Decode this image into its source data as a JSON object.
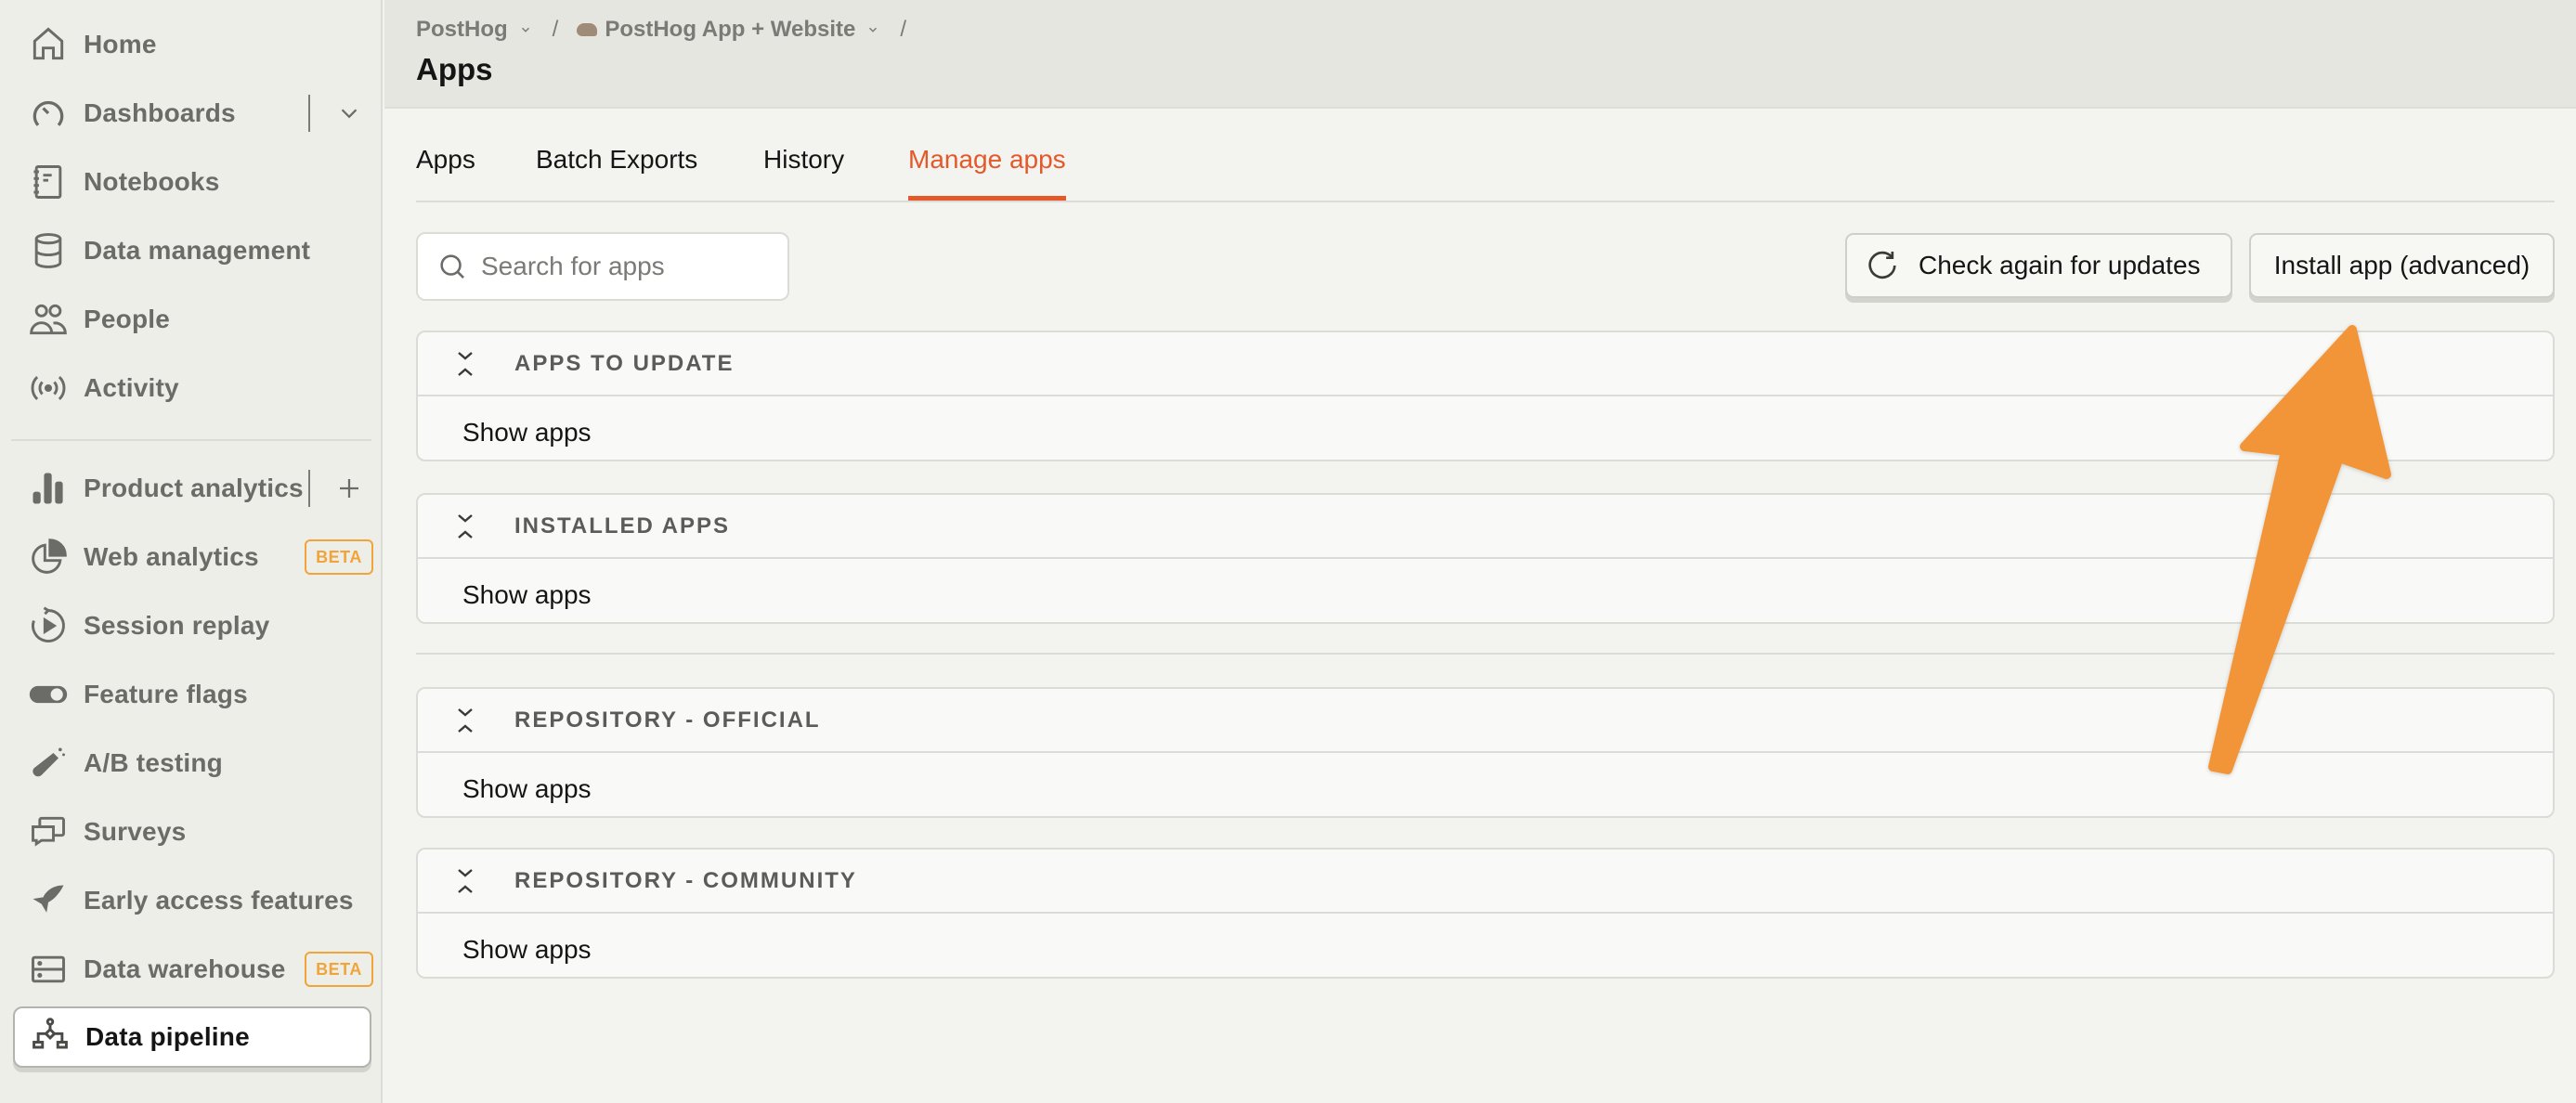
{
  "sidebar": {
    "items": [
      {
        "label": "Home",
        "icon": "home-icon"
      },
      {
        "label": "Dashboards",
        "icon": "gauge-icon",
        "side_action": "chevron-down-icon"
      },
      {
        "label": "Notebooks",
        "icon": "notebook-icon"
      },
      {
        "label": "Data management",
        "icon": "database-icon"
      },
      {
        "label": "People",
        "icon": "people-icon"
      },
      {
        "label": "Activity",
        "icon": "broadcast-icon"
      },
      {
        "label": "Product analytics",
        "icon": "bar-chart-icon",
        "side_action": "plus-icon"
      },
      {
        "label": "Web analytics",
        "icon": "pie-chart-icon",
        "badge": "BETA"
      },
      {
        "label": "Session replay",
        "icon": "replay-icon"
      },
      {
        "label": "Feature flags",
        "icon": "toggle-icon"
      },
      {
        "label": "A/B testing",
        "icon": "flask-icon"
      },
      {
        "label": "Surveys",
        "icon": "chat-bubbles-icon"
      },
      {
        "label": "Early access features",
        "icon": "rocket-icon"
      },
      {
        "label": "Data warehouse",
        "icon": "server-icon",
        "badge": "BETA"
      },
      {
        "label": "Data pipeline",
        "icon": "pipeline-icon",
        "active": true
      }
    ]
  },
  "header": {
    "breadcrumb": [
      {
        "label": "PostHog",
        "dropdown": true
      },
      {
        "label": "PostHog App + Website",
        "dropdown": true,
        "icon": "hedgehog-icon"
      }
    ],
    "separator": "/",
    "title": "Apps"
  },
  "tabs": [
    {
      "label": "Apps",
      "active": false
    },
    {
      "label": "Batch Exports",
      "active": false
    },
    {
      "label": "History",
      "active": false
    },
    {
      "label": "Manage apps",
      "active": true
    }
  ],
  "toolbar": {
    "search_placeholder": "Search for apps",
    "search_value": "",
    "check_updates_label": "Check again for updates",
    "install_label": "Install app (advanced)"
  },
  "sections": [
    {
      "title": "APPS TO UPDATE",
      "action": "Show apps"
    },
    {
      "title": "INSTALLED APPS",
      "action": "Show apps"
    },
    {
      "title": "REPOSITORY - OFFICIAL",
      "action": "Show apps"
    },
    {
      "title": "REPOSITORY - COMMUNITY",
      "action": "Show apps"
    }
  ],
  "colors": {
    "accent": "#e5582a",
    "beta_badge": "#f0a43a",
    "annotation_arrow": "#f29539"
  },
  "annotation": {
    "type": "arrow",
    "points_to": "install-app-button"
  }
}
